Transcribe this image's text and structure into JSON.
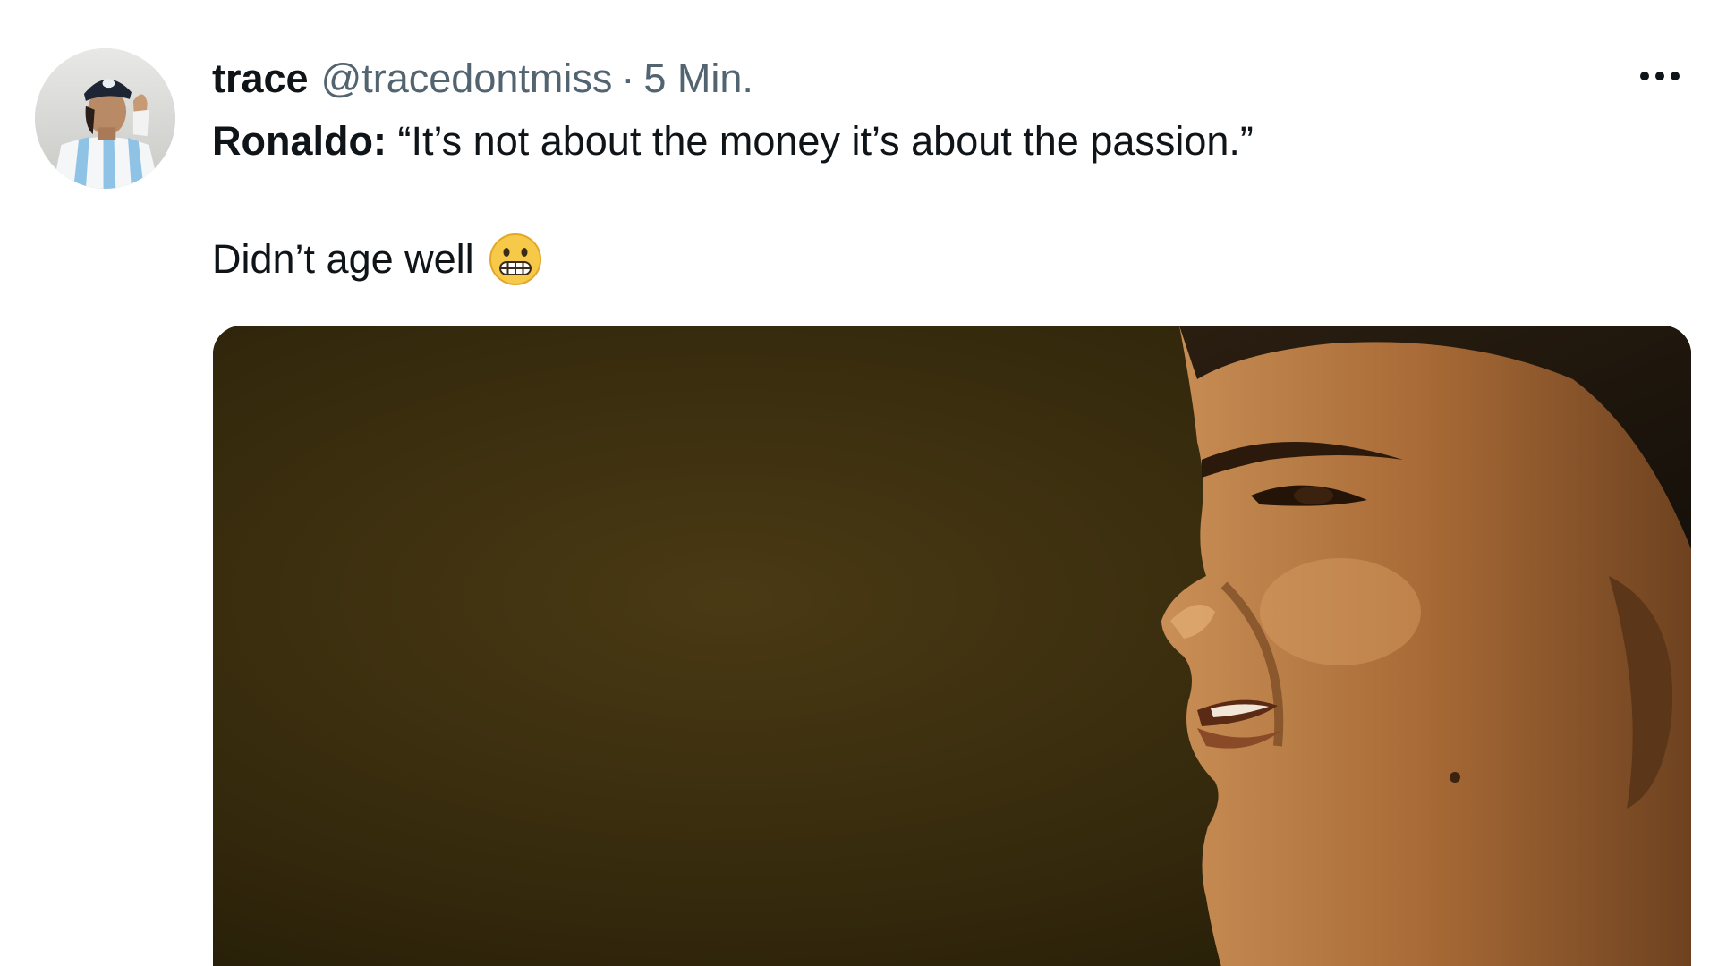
{
  "tweet": {
    "author": {
      "display_name": "trace",
      "handle": "@tracedontmiss",
      "avatar_icon": "profile-photo"
    },
    "separator": "·",
    "time": "5 Min.",
    "more_icon": "more-horizontal-icon",
    "text": {
      "speaker": "Ronaldo:",
      "quote": "“It’s not about the money it’s about the passion.”",
      "line2": "Didn’t age well",
      "emoji": "grimacing-face-emoji"
    },
    "media": {
      "type": "video-still"
    }
  },
  "colors": {
    "text_primary": "#0f1419",
    "text_secondary": "#536471",
    "background": "#ffffff"
  }
}
